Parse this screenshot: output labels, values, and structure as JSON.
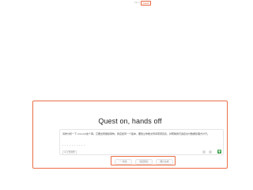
{
  "header": {
    "tabs": [
      {
        "label": "Mind",
        "active": false
      },
      {
        "label": "Quest",
        "active": true
      }
    ]
  },
  "main": {
    "title": "Quest on, hands off"
  },
  "composer": {
    "text": "请你分析一下 xxxx.prd这个库。它要出所继续架构，我应如何一个股本，要建立你能交待间项项目表，并帮助我们追接交付数据处理方计行。",
    "attach_label": "上传文件",
    "colors": {
      "send": "#3aa14a"
    }
  },
  "options": [
    {
      "label": "一 想法"
    },
    {
      "label": "深度研究"
    },
    {
      "label": "图片生成"
    }
  ],
  "theme": {
    "accent": "#eb6f47"
  }
}
